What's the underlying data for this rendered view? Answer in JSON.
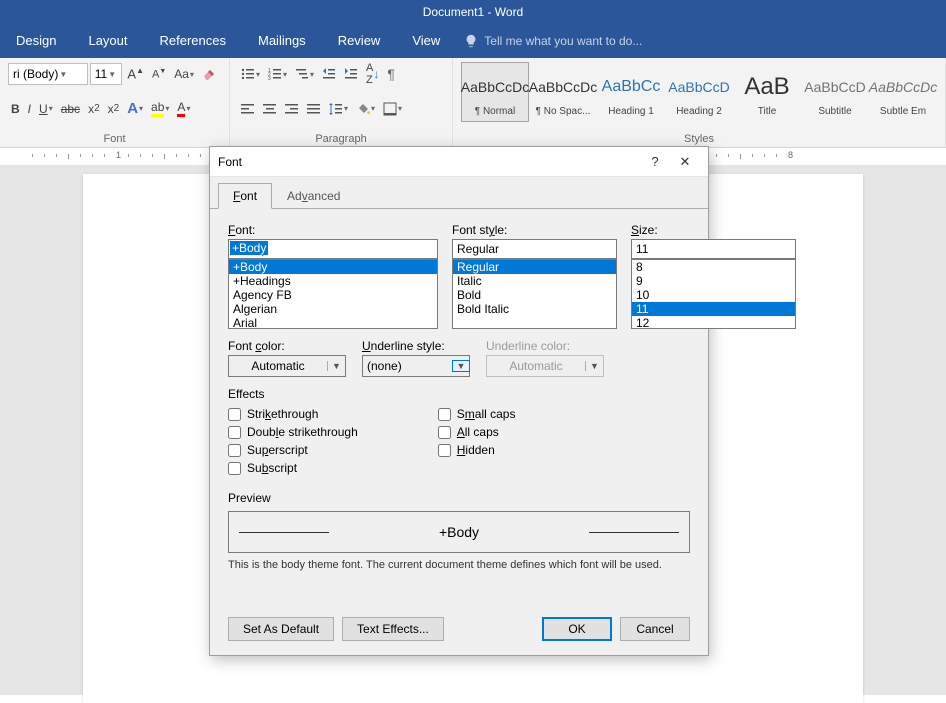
{
  "app": {
    "title": "Document1 - Word"
  },
  "ribbon_tabs": [
    "Design",
    "Layout",
    "References",
    "Mailings",
    "Review",
    "View"
  ],
  "tell_me": "Tell me what you want to do...",
  "font_group": {
    "font_name": "ri (Body)",
    "font_size": "11",
    "label": "Font"
  },
  "paragraph_group": {
    "label": "Paragraph"
  },
  "styles": {
    "label": "Styles",
    "items": [
      {
        "preview": "AaBbCcDc",
        "name": "¶ Normal",
        "selected": true,
        "color": "#333"
      },
      {
        "preview": "AaBbCcDc",
        "name": "¶ No Spac...",
        "selected": false,
        "color": "#333"
      },
      {
        "preview": "AaBbCc",
        "name": "Heading 1",
        "selected": false,
        "color": "#2e74b5",
        "size": "16px"
      },
      {
        "preview": "AaBbCcD",
        "name": "Heading 2",
        "selected": false,
        "color": "#2e74b5",
        "size": "14px"
      },
      {
        "preview": "AaB",
        "name": "Title",
        "selected": false,
        "color": "#333",
        "size": "24px"
      },
      {
        "preview": "AaBbCcD",
        "name": "Subtitle",
        "selected": false,
        "color": "#767171"
      },
      {
        "preview": "AaBbCcDc",
        "name": "Subtle Em",
        "selected": false,
        "color": "#767171",
        "italic": true
      }
    ]
  },
  "dialog": {
    "title": "Font",
    "help": "?",
    "close": "✕",
    "tabs": {
      "font": "Font",
      "advanced": "Advanced"
    },
    "labels": {
      "font": "Font:",
      "font_style": "Font style:",
      "size": "Size:",
      "font_color": "Font color:",
      "underline_style": "Underline style:",
      "underline_color": "Underline color:",
      "effects": "Effects",
      "preview": "Preview"
    },
    "font_input": "+Body",
    "font_list": [
      "+Body",
      "+Headings",
      "Agency FB",
      "Algerian",
      "Arial"
    ],
    "font_list_selected": 0,
    "style_input": "Regular",
    "style_list": [
      "Regular",
      "Italic",
      "Bold",
      "Bold Italic"
    ],
    "style_list_selected": 0,
    "size_input": "11",
    "size_list": [
      "8",
      "9",
      "10",
      "11",
      "12"
    ],
    "size_list_selected": 3,
    "font_color": "Automatic",
    "underline_style": "(none)",
    "underline_color": "Automatic",
    "effects": {
      "strikethrough": "Strikethrough",
      "double_strikethrough": "Double strikethrough",
      "superscript": "Superscript",
      "subscript": "Subscript",
      "small_caps": "Small caps",
      "all_caps": "All caps",
      "hidden": "Hidden"
    },
    "preview_text": "+Body",
    "preview_desc": "This is the body theme font. The current document theme defines which font will be used.",
    "buttons": {
      "set_default": "Set As Default",
      "text_effects": "Text Effects...",
      "ok": "OK",
      "cancel": "Cancel"
    }
  }
}
